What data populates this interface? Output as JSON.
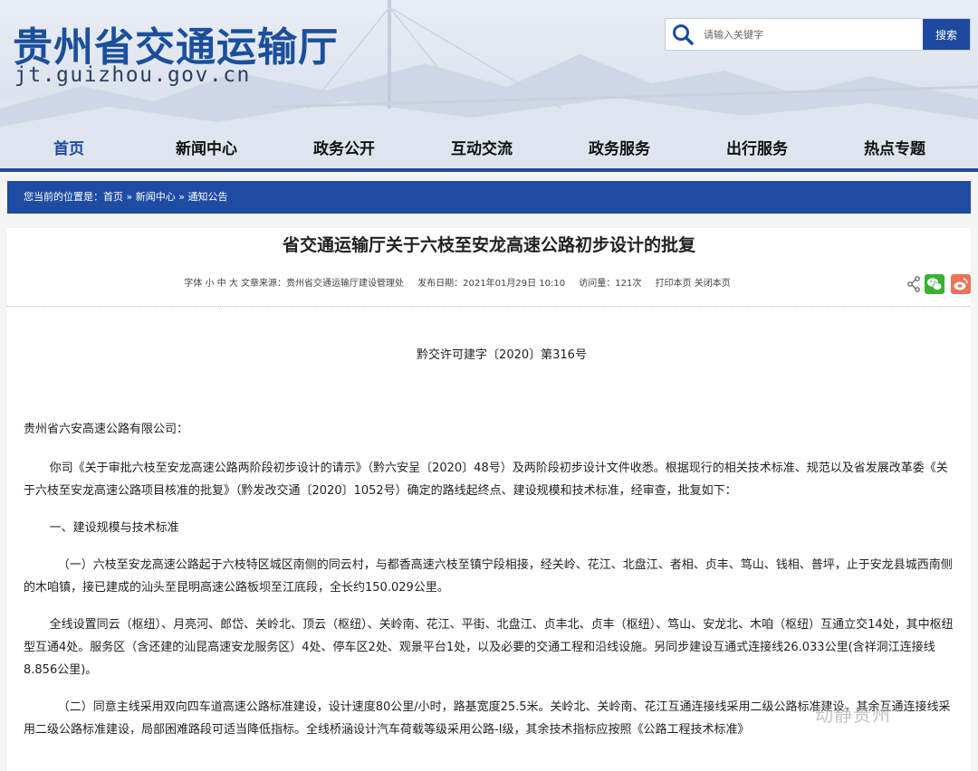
{
  "header": {
    "site_title": "贵州省交通运输厅",
    "site_url": "jt.guizhou.gov.cn",
    "search": {
      "placeholder": "请输入关键字",
      "button": "搜索"
    }
  },
  "nav": {
    "items": [
      {
        "label": "首页",
        "active": true
      },
      {
        "label": "新闻中心"
      },
      {
        "label": "政务公开"
      },
      {
        "label": "互动交流"
      },
      {
        "label": "政务服务"
      },
      {
        "label": "出行服务"
      },
      {
        "label": "热点专题"
      }
    ]
  },
  "breadcrumb": {
    "prefix": "您当前的位置是：",
    "path": [
      "首页",
      "新闻中心",
      "通知公告"
    ],
    "separator": " » "
  },
  "article": {
    "title": "省交通运输厅关于六枝至安龙高速公路初步设计的批复",
    "meta": {
      "font_label": "字体",
      "font_sizes": [
        "小",
        "中",
        "大"
      ],
      "source": "文章来源：贵州省交通运输厅建设管理处",
      "date": "发布日期：2021年01月29日 10:10",
      "views": "访问量：121次",
      "print": "打印本页",
      "close": "关闭本页"
    },
    "doc_number": "黔交许可建字〔2020〕第316号",
    "paragraphs": [
      "贵州省六安高速公路有限公司：",
      "你司《关于审批六枝至安龙高速公路两阶段初步设计的请示》（黔六安呈〔2020〕48号）及两阶段初步设计文件收悉。根据现行的相关技术标准、规范以及省发展改革委《关于六枝至安龙高速公路项目核准的批复》（黔发改交通〔2020〕1052号）确定的路线起终点、建设规模和技术标准，经审查，批复如下：",
      "一、建设规模与技术标准",
      "（一）六枝至安龙高速公路起于六枝特区城区南侧的同云村，与都香高速六枝至镇宁段相接，经关岭、花江、北盘江、者相、贞丰、笃山、钱相、普坪，止于安龙县城西南侧的木咱镇，接已建成的汕头至昆明高速公路板坝至江底段，全长约150.029公里。",
      "全线设置同云（枢纽）、月亮河、郎岱、关岭北、顶云（枢纽）、关岭南、花江、平街、北盘江、贞丰北、贞丰（枢纽）、笃山、安龙北、木咱（枢纽）互通立交14处，其中枢纽型互通4处。服务区（含还建的汕昆高速安龙服务区）4处、停车区2处、观景平台1处，以及必要的交通工程和沿线设施。另同步建设互通式连接线26.033公里(含祥洞江连接线8.856公里)。",
      "（二）同意主线采用双向四车道高速公路标准建设，设计速度80公里/小时，路基宽度25.5米。关岭北、关岭南、花江互通连接线采用二级公路标准建设，其余互通连接线采用二级公路标准建设，局部困难路段可适当降低指标。全线桥涵设计汽车荷载等级采用公路-I级，其余技术指标应按照《公路工程技术标准》"
    ]
  },
  "watermark": "动静贵州",
  "colors": {
    "brand_blue": "#1d4a9e",
    "crumb_blue": "#1e4ca3",
    "wechat": "#3cb034",
    "weibo": "#e8745a"
  }
}
